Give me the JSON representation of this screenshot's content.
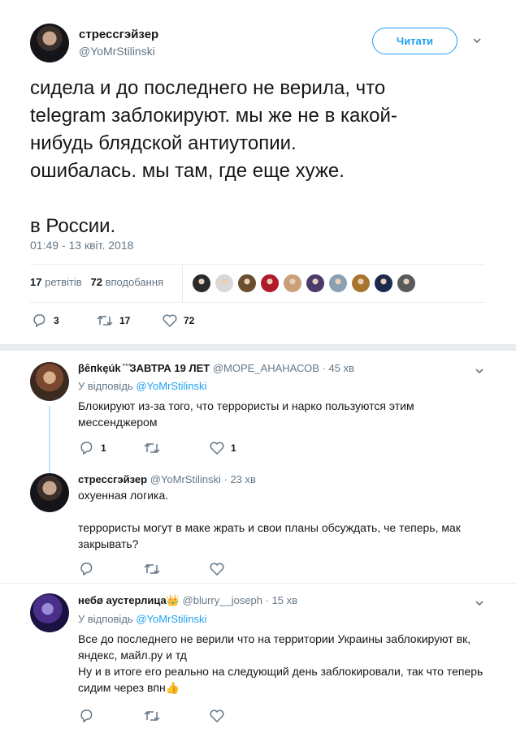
{
  "tweet": {
    "author_name": "стрессгэйзер",
    "author_handle": "@YoMrStilinski",
    "follow_label": "Читати",
    "text": "сидела и до последнего не верила, что\ntelegram заблокируют. мы же не в какой-\nнибудь блядской антиутопии.\nошибалась. мы там, где еще хуже.\n\nв России.",
    "timestamp": "01:49 - 13 квіт. 2018",
    "retweets_count": "17",
    "retweets_label": "ретвітів",
    "likes_count": "72",
    "likes_label": "вподобання",
    "actions": {
      "replies": "3",
      "retweets": "17",
      "likes": "72"
    },
    "liker_avatar_colors": [
      "#2a2a2a",
      "#d8d8d8",
      "#6b4e2e",
      "#b11a2a",
      "#c9a07a",
      "#4a3b6b",
      "#8aa0b5",
      "#a8752f",
      "#1d2a4d",
      "#5a5a5a"
    ]
  },
  "replies": [
    {
      "author_name": "βêпkęúk ̊ ̊ ̊ЗАВТРА 19 ЛЕТ",
      "author_handle": "@МОРЕ_АНАНАСОВ",
      "time": "· 45 хв",
      "reply_prefix": "У відповідь",
      "reply_to": "@YoMrStilinski",
      "text": "Блокируют из-за того, что террористы и нарко пользуются этим\nмессенджером",
      "replies": "1",
      "retweets": "",
      "likes": "1",
      "avatar_color": "#8a5a3a"
    },
    {
      "author_name": "стрессгэйзер",
      "author_handle": "@YoMrStilinski",
      "time": "· 23 хв",
      "text": "охуенная логика.\n\nтеррористы могут в маке жрать и свои планы обсуждать, че теперь, мак\nзакрывать?",
      "replies": "",
      "retweets": "",
      "likes": "",
      "avatar_color": "#2b2b33"
    },
    {
      "author_name": "небø аустерлица",
      "author_handle": "@blurry__joseph",
      "time": "· 15 хв",
      "reply_prefix": "У відповідь",
      "reply_to": "@YoMrStilinski",
      "text": "Все до последнего не верили что на территории Украины заблокируют вк,\nяндекс, майл.ру и тд\nНу и в итоге его реально на следующий день заблокировали, так что теперь\nсидим через впн👍",
      "replies": "",
      "retweets": "",
      "likes": "",
      "avatar_color": "#3a2a7a"
    }
  ],
  "colors": {
    "accent": "#1da1f2",
    "muted": "#657786",
    "border": "#e6ecf0"
  }
}
